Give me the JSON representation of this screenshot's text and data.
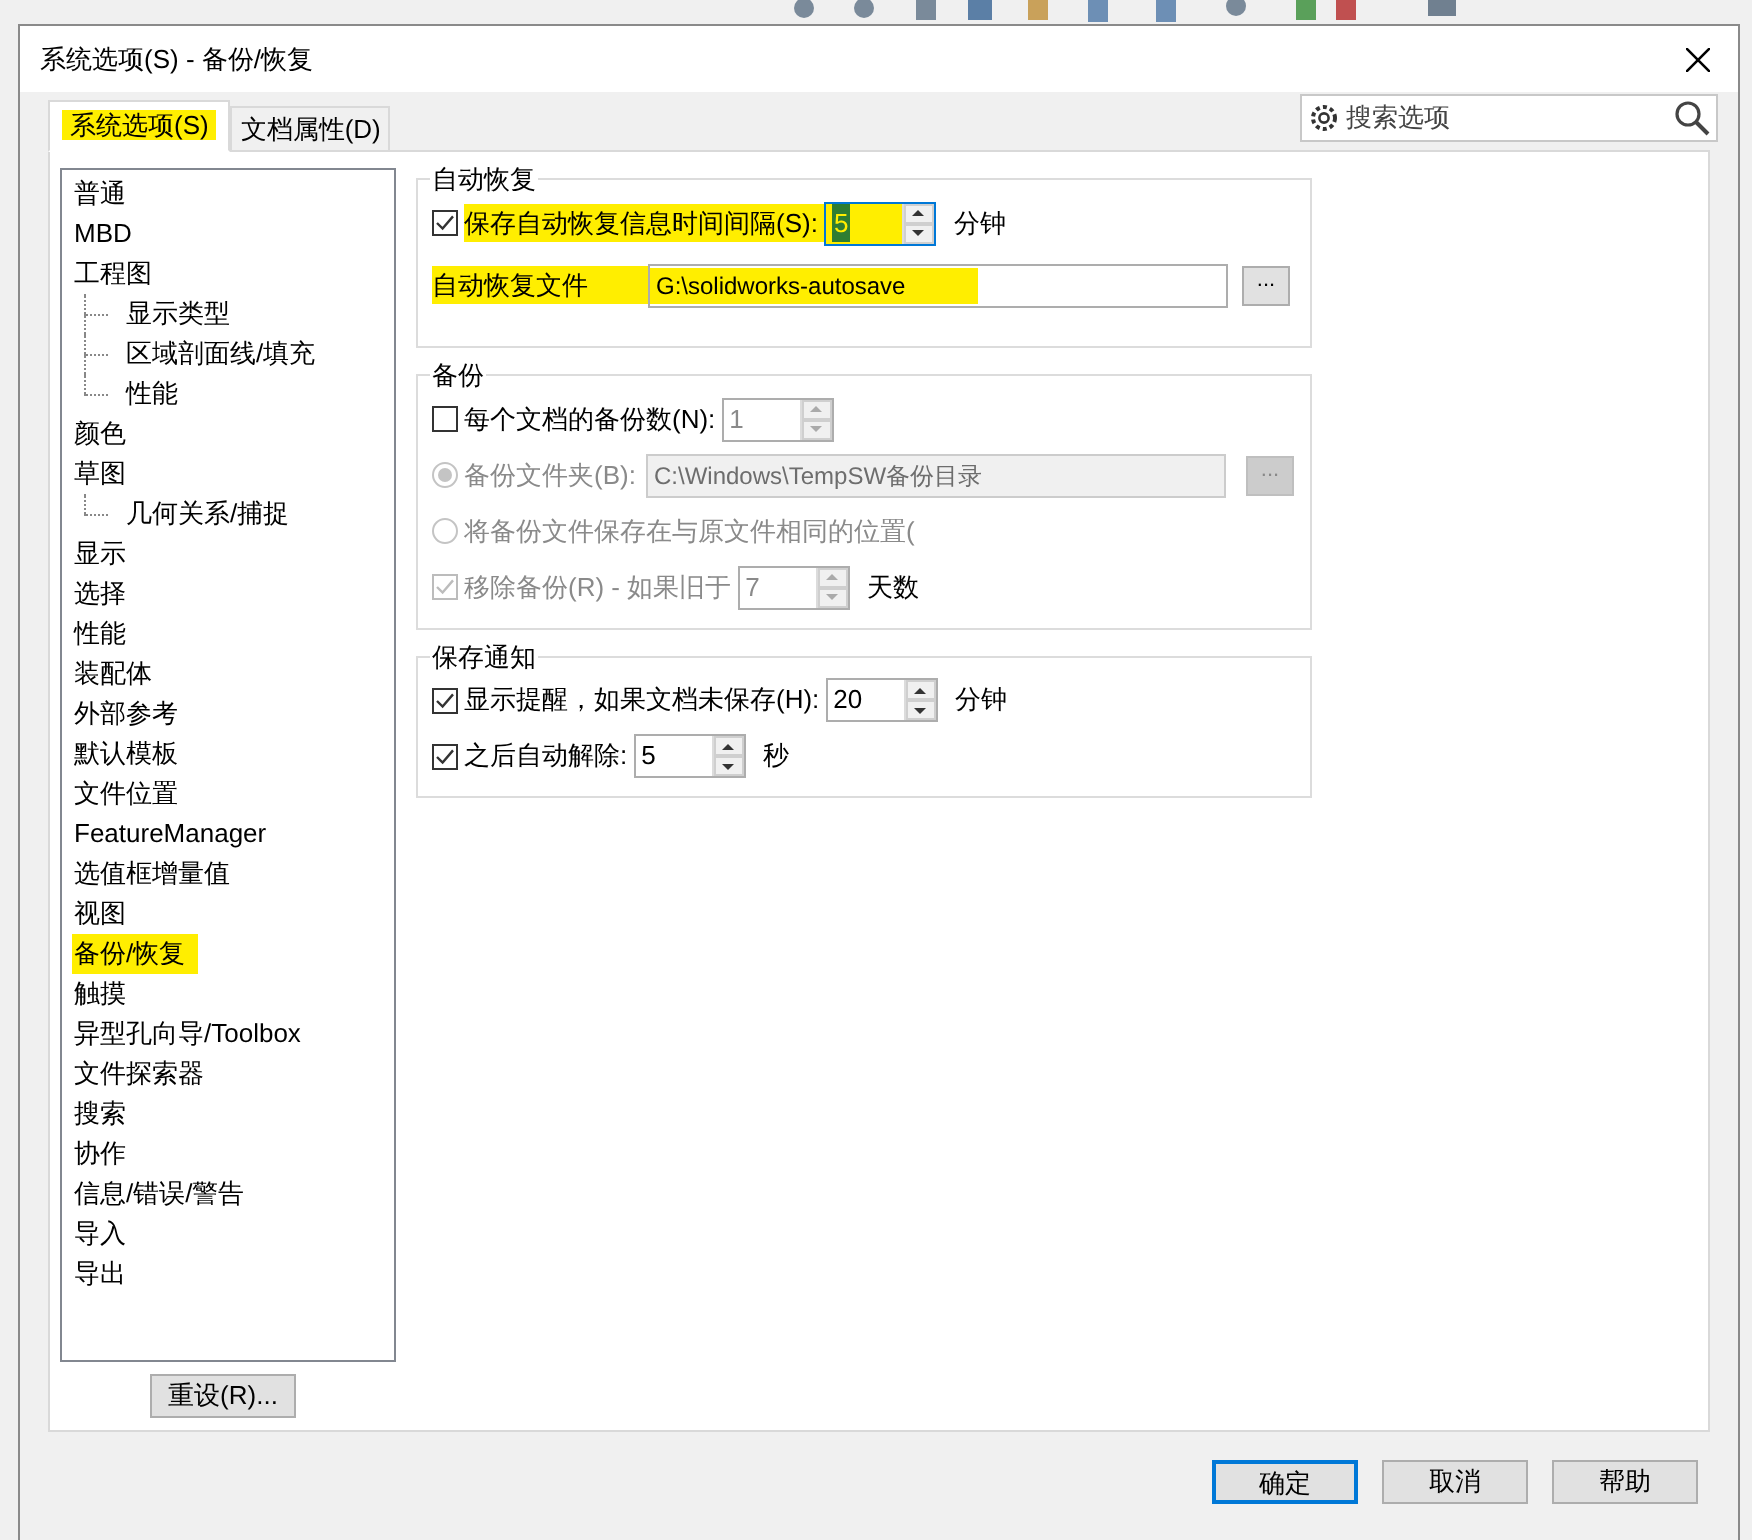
{
  "window": {
    "title": "系统选项(S) - 备份/恢复"
  },
  "tabs": [
    {
      "label": "系统选项(S)",
      "selected": true,
      "highlighted": true
    },
    {
      "label": "文档属性(D)",
      "selected": false,
      "highlighted": false
    }
  ],
  "search": {
    "placeholder": "搜索选项"
  },
  "tree": [
    {
      "label": "普通",
      "selected": false
    },
    {
      "label": "MBD",
      "selected": false
    },
    {
      "label": "工程图",
      "selected": false,
      "children": [
        {
          "label": "显示类型",
          "selected": false
        },
        {
          "label": "区域剖面线/填充",
          "selected": false
        },
        {
          "label": "性能",
          "selected": false
        }
      ]
    },
    {
      "label": "颜色",
      "selected": false
    },
    {
      "label": "草图",
      "selected": false,
      "children": [
        {
          "label": "几何关系/捕捉",
          "selected": false
        }
      ]
    },
    {
      "label": "显示",
      "selected": false
    },
    {
      "label": "选择",
      "selected": false
    },
    {
      "label": "性能",
      "selected": false
    },
    {
      "label": "装配体",
      "selected": false
    },
    {
      "label": "外部参考",
      "selected": false
    },
    {
      "label": "默认模板",
      "selected": false
    },
    {
      "label": "文件位置",
      "selected": false
    },
    {
      "label": "FeatureManager",
      "selected": false
    },
    {
      "label": "选值框增量值",
      "selected": false
    },
    {
      "label": "视图",
      "selected": false
    },
    {
      "label": "备份/恢复",
      "selected": true,
      "highlighted": true
    },
    {
      "label": "触摸",
      "selected": false
    },
    {
      "label": "异型孔向导/Toolbox",
      "selected": false
    },
    {
      "label": "文件探索器",
      "selected": false
    },
    {
      "label": "搜索",
      "selected": false
    },
    {
      "label": "协作",
      "selected": false
    },
    {
      "label": "信息/错误/警告",
      "selected": false
    },
    {
      "label": "导入",
      "selected": false
    },
    {
      "label": "导出",
      "selected": false
    }
  ],
  "reset_button": "重设(R)...",
  "groups": [
    {
      "title": "自动恢复",
      "rows": [
        {
          "kind": "check_spin",
          "label": "保存自动恢复信息时间间隔(S):",
          "checked": true,
          "disabled": false,
          "value": "5",
          "unit": "分钟",
          "focused": true,
          "highlighted": true
        },
        {
          "kind": "path",
          "label": "自动恢复文件",
          "value": "G:\\solidworks-autosave",
          "browse": "...",
          "disabled": false,
          "highlighted": true
        }
      ]
    },
    {
      "title": "备份",
      "rows": [
        {
          "kind": "check_spin",
          "label": "每个文档的备份数(N):",
          "checked": false,
          "disabled": false,
          "value": "1",
          "focused": false
        },
        {
          "kind": "radio_path",
          "label": "备份文件夹(B):",
          "selected": true,
          "disabled": true,
          "value": "C:\\Windows\\TempSW备份目录",
          "browse": "..."
        },
        {
          "kind": "radio",
          "label": "将备份文件保存在与原文件相同的位置(",
          "selected": false,
          "disabled": true
        },
        {
          "kind": "check_spin",
          "label": "移除备份(R) - 如果旧于",
          "checked": true,
          "disabled": true,
          "value": "7",
          "unit": "天数",
          "focused": false
        }
      ]
    },
    {
      "title": "保存通知",
      "rows": [
        {
          "kind": "check_spin",
          "label": "显示提醒，如果文档未保存(H):",
          "checked": true,
          "disabled": false,
          "value": "20",
          "unit": "分钟",
          "focused": false
        },
        {
          "kind": "check_spin",
          "label": "之后自动解除:",
          "checked": true,
          "disabled": false,
          "value": "5",
          "unit": "秒",
          "focused": false
        }
      ]
    }
  ],
  "buttons": [
    {
      "label": "确定",
      "default": true
    },
    {
      "label": "取消",
      "default": false
    },
    {
      "label": "帮助",
      "default": false
    }
  ]
}
